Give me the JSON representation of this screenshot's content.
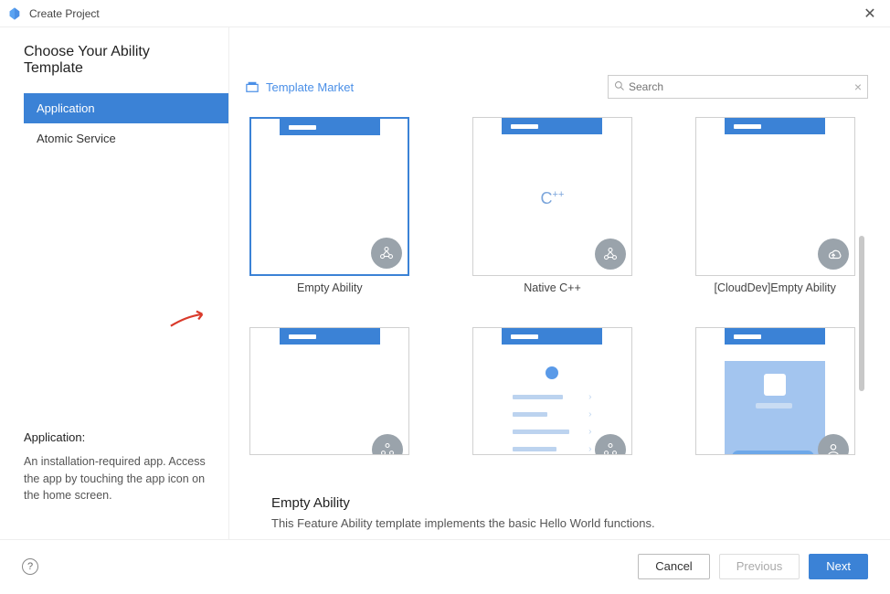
{
  "window": {
    "title": "Create Project"
  },
  "heading": "Choose Your Ability Template",
  "tabs": [
    {
      "label": "Application",
      "active": true
    },
    {
      "label": "Atomic Service",
      "active": false
    }
  ],
  "description": {
    "title": "Application:",
    "body": "An installation-required app. Access the app by touching the app icon on the home screen."
  },
  "market_link": "Template Market",
  "search": {
    "placeholder": "Search"
  },
  "templates": [
    {
      "label": "Empty Ability",
      "kind": "empty",
      "selected": true
    },
    {
      "label": "Native C++",
      "kind": "cpp",
      "selected": false
    },
    {
      "label": "[CloudDev]Empty Ability",
      "kind": "cloud",
      "selected": false
    },
    {
      "label": "",
      "kind": "empty2",
      "selected": false
    },
    {
      "label": "",
      "kind": "list",
      "selected": false
    },
    {
      "label": "",
      "kind": "profile",
      "selected": false
    }
  ],
  "selected_detail": {
    "title": "Empty Ability",
    "desc": "This Feature Ability template implements the basic Hello World functions."
  },
  "footer": {
    "cancel": "Cancel",
    "previous": "Previous",
    "next": "Next"
  }
}
